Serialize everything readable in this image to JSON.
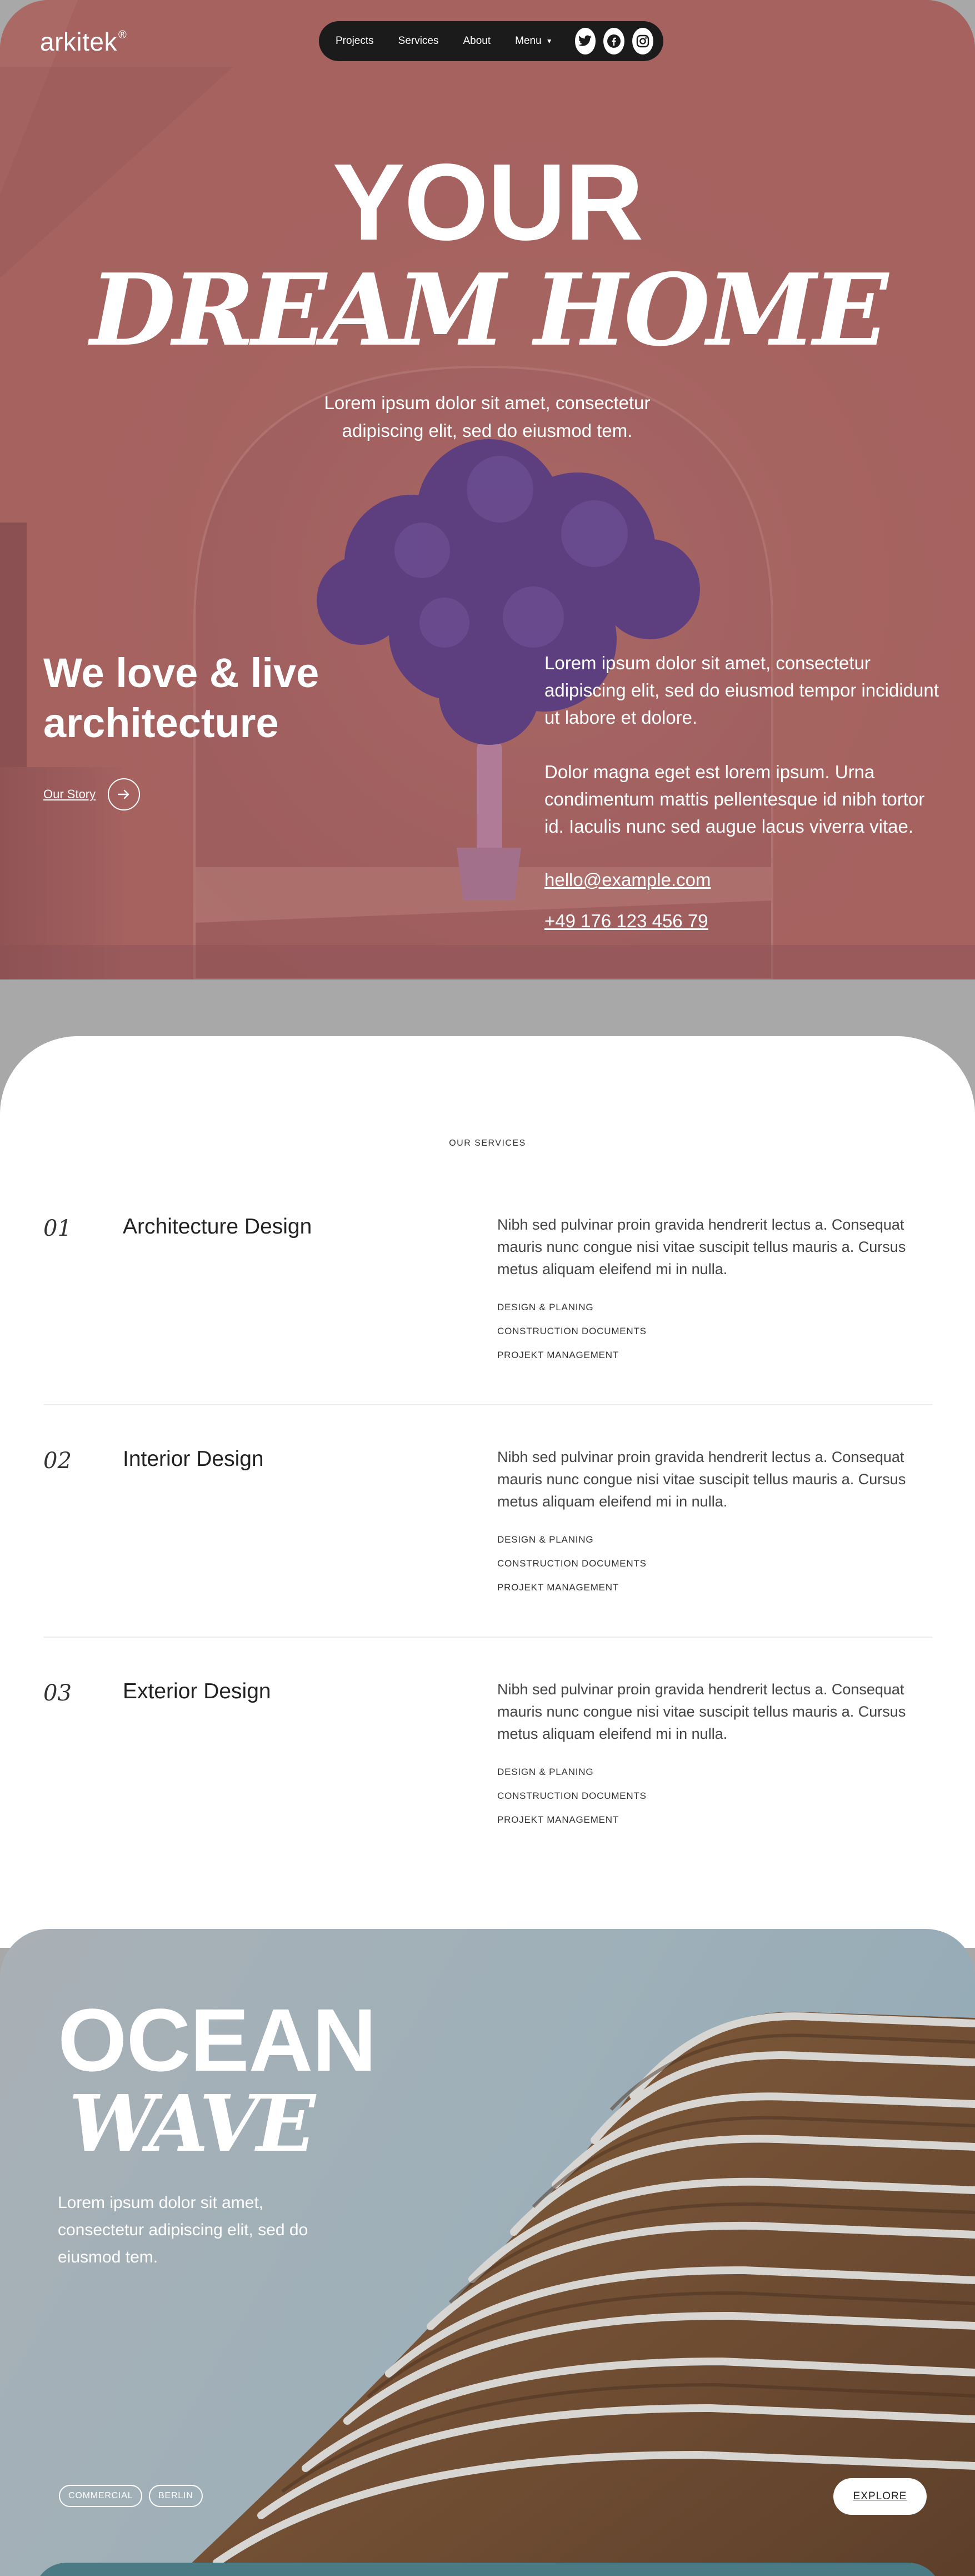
{
  "brand": {
    "name": "arkitek",
    "mark": "®"
  },
  "nav": {
    "links": [
      "Projects",
      "Services",
      "About"
    ],
    "menu_label": "Menu",
    "social_icons": [
      "twitter-icon",
      "facebook-icon",
      "instagram-icon"
    ]
  },
  "hero": {
    "title_line1": "YOUR",
    "title_line2": "DREAM HOME",
    "subtitle": "Lorem ipsum dolor sit amet, consectetur adipiscing elit, sed do eiusmod tem.",
    "heading": "We love & live architecture",
    "story_link": "Our Story",
    "paragraph1": "Lorem ipsum dolor sit amet, consectetur adipiscing elit, sed do eiusmod tempor incididunt ut labore et dolore.",
    "paragraph2": "Dolor magna eget est lorem ipsum. Urna condimentum mattis pellentesque id nibh tortor id. Iaculis nunc sed augue lacus viverra vitae.",
    "email": "hello@example.com",
    "phone": "+49 176 123 456 79"
  },
  "services": {
    "eyebrow": "OUR SERVICES",
    "items": [
      {
        "number": "01",
        "title": "Architecture Design",
        "description": "Nibh sed pulvinar proin gravida hendrerit lectus a. Consequat mauris nunc congue nisi vitae suscipit tellus mauris a. Cursus metus aliquam eleifend mi in nulla.",
        "tags": [
          "DESIGN & PLANING",
          "CONSTRUCTION DOCUMENTS",
          "PROJEKT MANAGEMENT"
        ]
      },
      {
        "number": "02",
        "title": "Interior Design",
        "description": "Nibh sed pulvinar proin gravida hendrerit lectus a. Consequat mauris nunc congue nisi vitae suscipit tellus mauris a. Cursus metus aliquam eleifend mi in nulla.",
        "tags": [
          "DESIGN & PLANING",
          "CONSTRUCTION DOCUMENTS",
          "PROJEKT MANAGEMENT"
        ]
      },
      {
        "number": "03",
        "title": "Exterior Design",
        "description": "Nibh sed pulvinar proin gravida hendrerit lectus a. Consequat mauris nunc congue nisi vitae suscipit tellus mauris a. Cursus metus aliquam eleifend mi in nulla.",
        "tags": [
          "DESIGN & PLANING",
          "CONSTRUCTION DOCUMENTS",
          "PROJEKT MANAGEMENT"
        ]
      }
    ]
  },
  "project": {
    "title_line1": "OCEAN",
    "title_line2": "WAVE",
    "subtitle": "Lorem ipsum dolor sit amet, consectetur adipiscing elit, sed do eiusmod tem.",
    "tags": [
      "COMMERCIAL",
      "BERLIN"
    ],
    "cta": "EXPLORE"
  },
  "colors": {
    "hero_bg": "#a36563",
    "nav_bg": "#1b1b1b",
    "tree": "#5e3f82",
    "ocean_bg": "#9fb0b9",
    "building": "#7a5a3c"
  }
}
